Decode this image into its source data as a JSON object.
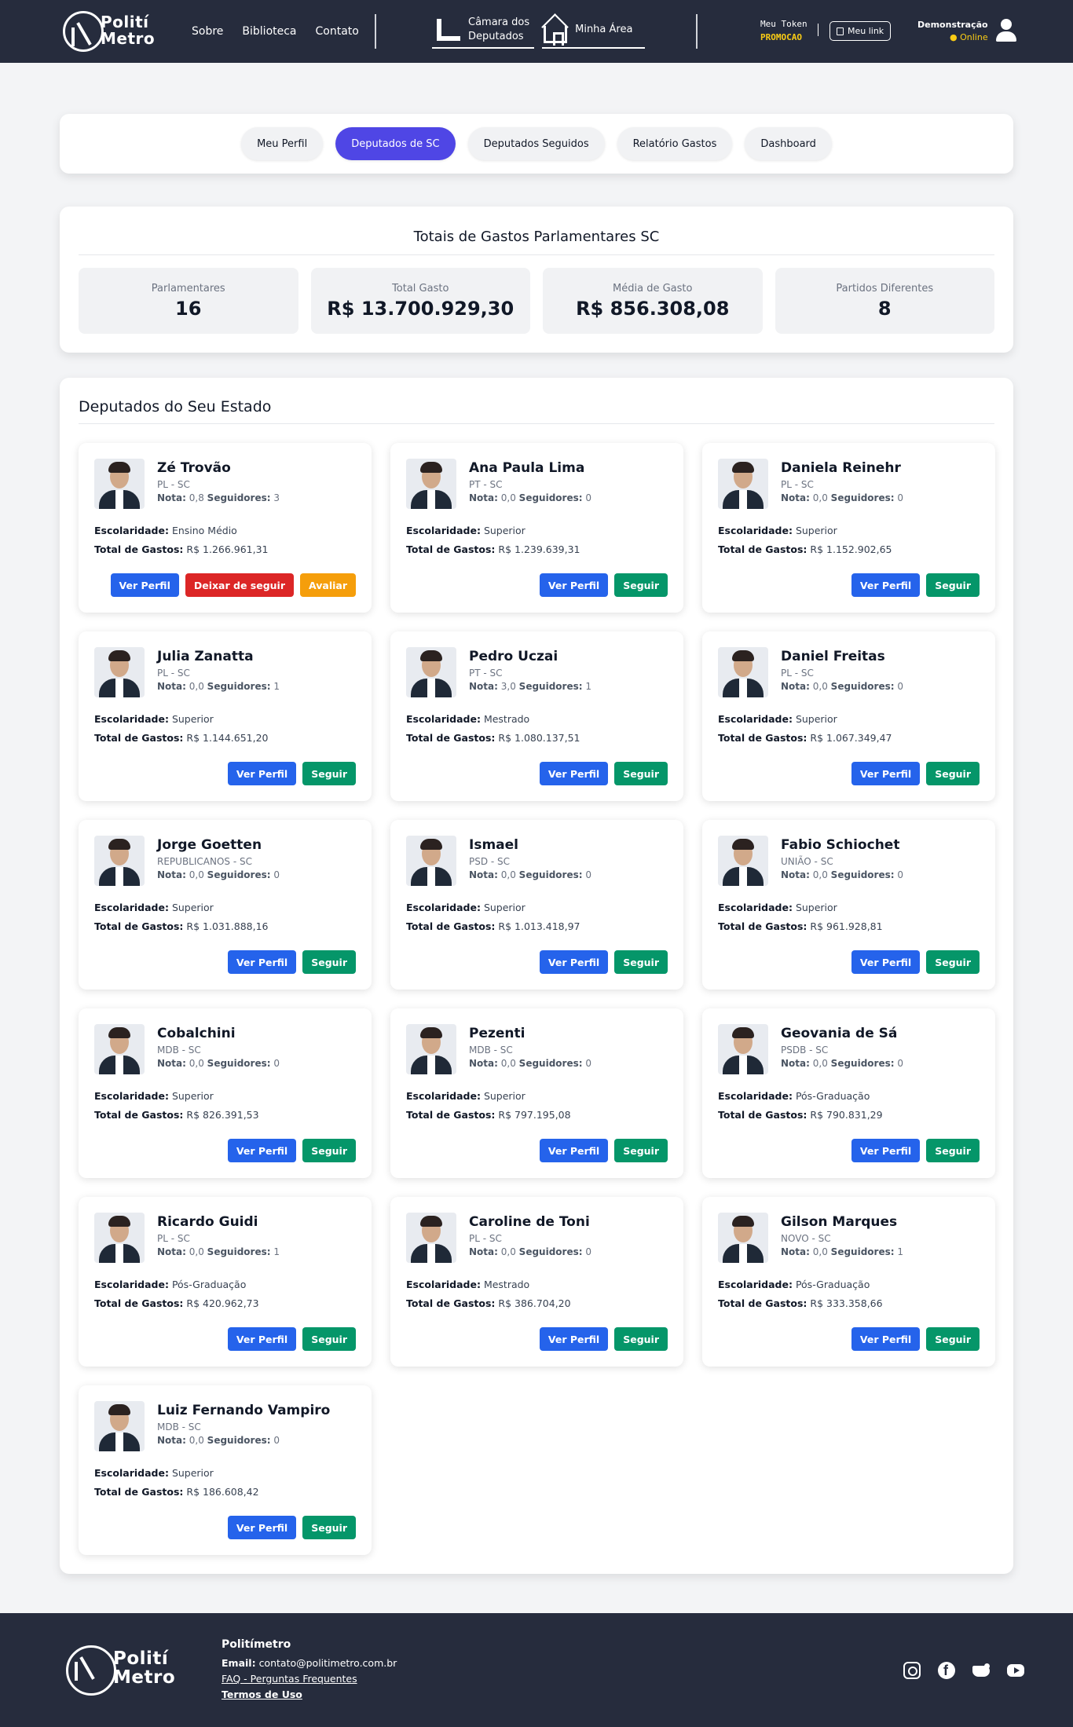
{
  "header": {
    "logo_line1": "Polití",
    "logo_line2": "Metro",
    "nav": [
      "Sobre",
      "Biblioteca",
      "Contato"
    ],
    "camara_line1": "Câmara dos",
    "camara_line2": "Deputados",
    "minha_area": "Minha Área",
    "token_label": "Meu Token",
    "token_value": "PROMOCAO",
    "my_link": "Meu link",
    "user_name": "Demonstração",
    "user_status": "● Online"
  },
  "tabs": [
    "Meu Perfil",
    "Deputados de SC",
    "Deputados Seguidos",
    "Relatório Gastos",
    "Dashboard"
  ],
  "totals": {
    "title": "Totais de Gastos Parlamentares SC",
    "stats": [
      {
        "label": "Parlamentares",
        "value": "16"
      },
      {
        "label": "Total Gasto",
        "value": "R$ 13.700.929,30"
      },
      {
        "label": "Média de Gasto",
        "value": "R$ 856.308,08"
      },
      {
        "label": "Partidos Diferentes",
        "value": "8"
      }
    ]
  },
  "deputados": {
    "title": "Deputados do Seu Estado",
    "labels": {
      "nota": "Nota:",
      "seguidores": "Seguidores:",
      "escolaridade": "Escolaridade:",
      "total": "Total de Gastos:",
      "ver_perfil": "Ver Perfil",
      "seguir": "Seguir",
      "deixar": "Deixar de seguir",
      "avaliar": "Avaliar"
    },
    "items": [
      {
        "name": "Zé Trovão",
        "party": "PL - SC",
        "nota": "0,8",
        "seguidores": "3",
        "escolaridade": "Ensino Médio",
        "total": "R$ 1.266.961,31",
        "following": true
      },
      {
        "name": "Ana Paula Lima",
        "party": "PT - SC",
        "nota": "0,0",
        "seguidores": "0",
        "escolaridade": "Superior",
        "total": "R$ 1.239.639,31",
        "following": false
      },
      {
        "name": "Daniela Reinehr",
        "party": "PL - SC",
        "nota": "0,0",
        "seguidores": "0",
        "escolaridade": "Superior",
        "total": "R$ 1.152.902,65",
        "following": false
      },
      {
        "name": "Julia Zanatta",
        "party": "PL - SC",
        "nota": "0,0",
        "seguidores": "1",
        "escolaridade": "Superior",
        "total": "R$ 1.144.651,20",
        "following": false
      },
      {
        "name": "Pedro Uczai",
        "party": "PT - SC",
        "nota": "3,0",
        "seguidores": "1",
        "escolaridade": "Mestrado",
        "total": "R$ 1.080.137,51",
        "following": false
      },
      {
        "name": "Daniel Freitas",
        "party": "PL - SC",
        "nota": "0,0",
        "seguidores": "0",
        "escolaridade": "Superior",
        "total": "R$ 1.067.349,47",
        "following": false
      },
      {
        "name": "Jorge Goetten",
        "party": "REPUBLICANOS - SC",
        "nota": "0,0",
        "seguidores": "0",
        "escolaridade": "Superior",
        "total": "R$ 1.031.888,16",
        "following": false
      },
      {
        "name": "Ismael",
        "party": "PSD - SC",
        "nota": "0,0",
        "seguidores": "0",
        "escolaridade": "Superior",
        "total": "R$ 1.013.418,97",
        "following": false
      },
      {
        "name": "Fabio Schiochet",
        "party": "UNIÃO - SC",
        "nota": "0,0",
        "seguidores": "0",
        "escolaridade": "Superior",
        "total": "R$ 961.928,81",
        "following": false
      },
      {
        "name": "Cobalchini",
        "party": "MDB - SC",
        "nota": "0,0",
        "seguidores": "0",
        "escolaridade": "Superior",
        "total": "R$ 826.391,53",
        "following": false
      },
      {
        "name": "Pezenti",
        "party": "MDB - SC",
        "nota": "0,0",
        "seguidores": "0",
        "escolaridade": "Superior",
        "total": "R$ 797.195,08",
        "following": false
      },
      {
        "name": "Geovania de Sá",
        "party": "PSDB - SC",
        "nota": "0,0",
        "seguidores": "0",
        "escolaridade": "Pós-Graduação",
        "total": "R$ 790.831,29",
        "following": false
      },
      {
        "name": "Ricardo Guidi",
        "party": "PL - SC",
        "nota": "0,0",
        "seguidores": "1",
        "escolaridade": "Pós-Graduação",
        "total": "R$ 420.962,73",
        "following": false
      },
      {
        "name": "Caroline de Toni",
        "party": "PL - SC",
        "nota": "0,0",
        "seguidores": "0",
        "escolaridade": "Mestrado",
        "total": "R$ 386.704,20",
        "following": false
      },
      {
        "name": "Gilson Marques",
        "party": "NOVO - SC",
        "nota": "0,0",
        "seguidores": "1",
        "escolaridade": "Pós-Graduação",
        "total": "R$ 333.358,66",
        "following": false
      },
      {
        "name": "Luiz Fernando Vampiro",
        "party": "MDB - SC",
        "nota": "0,0",
        "seguidores": "0",
        "escolaridade": "Superior",
        "total": "R$ 186.608,42",
        "following": false
      }
    ]
  },
  "footer": {
    "name": "Politímetro",
    "email_label": "Email:",
    "email": "contato@politimetro.com.br",
    "faq": "FAQ - Perguntas Frequentes",
    "terms": "Termos de Uso",
    "socials": [
      "instagram-icon",
      "facebook-icon",
      "twitter-icon",
      "youtube-icon"
    ]
  }
}
